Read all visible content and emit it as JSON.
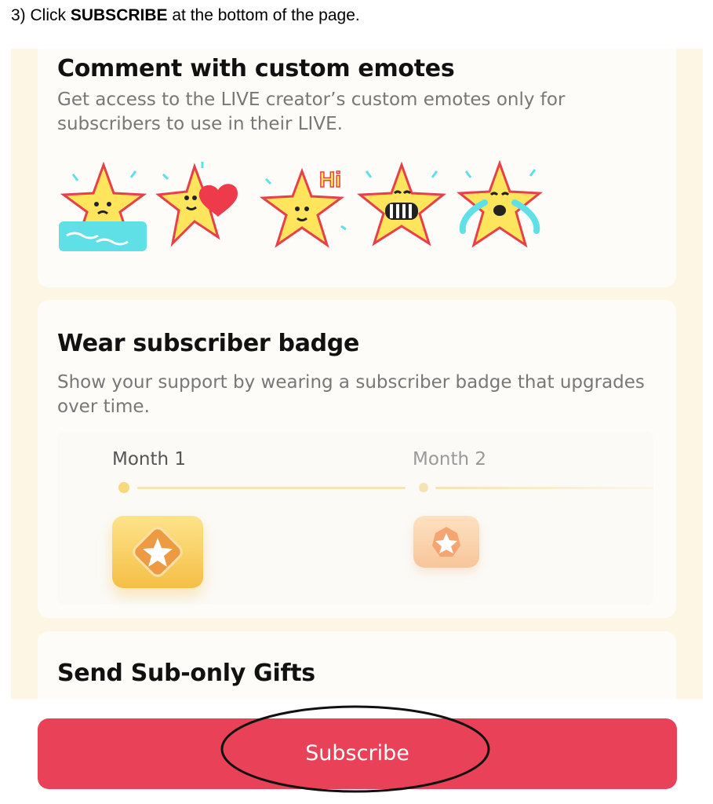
{
  "instruction": {
    "prefix": "3) Click ",
    "bold": "SUBSCRIBE",
    "suffix": " at the bottom of the page."
  },
  "cards": {
    "emotes": {
      "title": "Comment with custom emotes",
      "description": "Get access to the LIVE creator’s custom emotes only for subscribers to use in their LIVE.",
      "hi_text": "Hi",
      "emote_icons": [
        "crying-star-emote-icon",
        "heart-star-emote-icon",
        "waving-hi-star-emote-icon",
        "grinning-star-emote-icon",
        "tears-of-joy-star-emote-icon"
      ]
    },
    "badge": {
      "title": "Wear subscriber badge",
      "description": "Show your support by wearing a subscriber badge that upgrades over time.",
      "months": [
        "Month 1",
        "Month 2"
      ]
    },
    "gifts": {
      "title": "Send Sub-only Gifts"
    }
  },
  "button": {
    "label": "Subscribe"
  },
  "colors": {
    "accent": "#e84158",
    "background": "#fdf6e4",
    "card": "#fdfcf9",
    "badge_gold": "#f7c64a",
    "star_yellow": "#ffe55c"
  }
}
